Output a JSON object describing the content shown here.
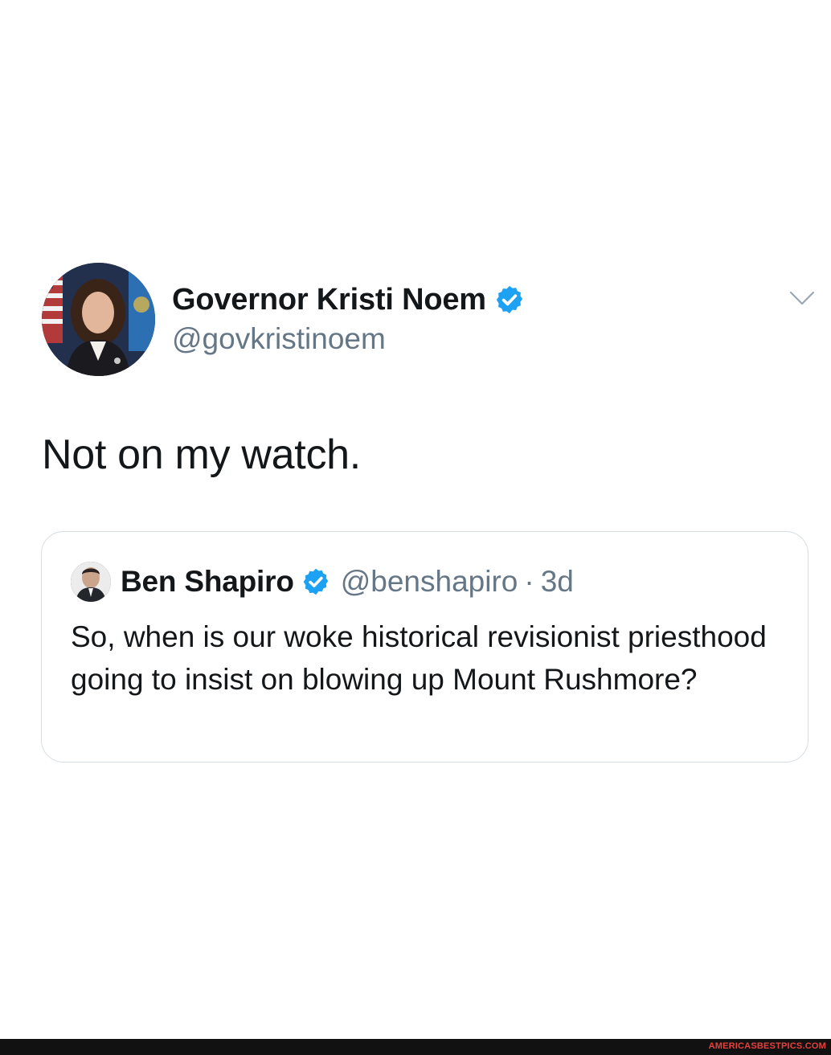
{
  "tweet": {
    "author": {
      "display_name": "Governor Kristi Noem",
      "handle": "@govkristinoem",
      "verified": true,
      "avatar_icon": "profile-photo"
    },
    "text": "Not on my watch.",
    "menu_icon": "chevron-down-icon"
  },
  "quoted_tweet": {
    "author": {
      "display_name": "Ben Shapiro",
      "handle": "@benshapiro",
      "verified": true,
      "avatar_icon": "profile-photo"
    },
    "separator": "·",
    "time": "3d",
    "text": "So, when is our woke historical revisionist priesthood going to insist on blowing up Mount Rushmore?"
  },
  "watermark": {
    "text": "AMERICASBESTPICS.COM"
  },
  "colors": {
    "verified_blue": "#1da1f2",
    "secondary_text": "#657786",
    "primary_text": "#14171a",
    "border": "#d6dde3",
    "watermark": "#e8413c"
  }
}
